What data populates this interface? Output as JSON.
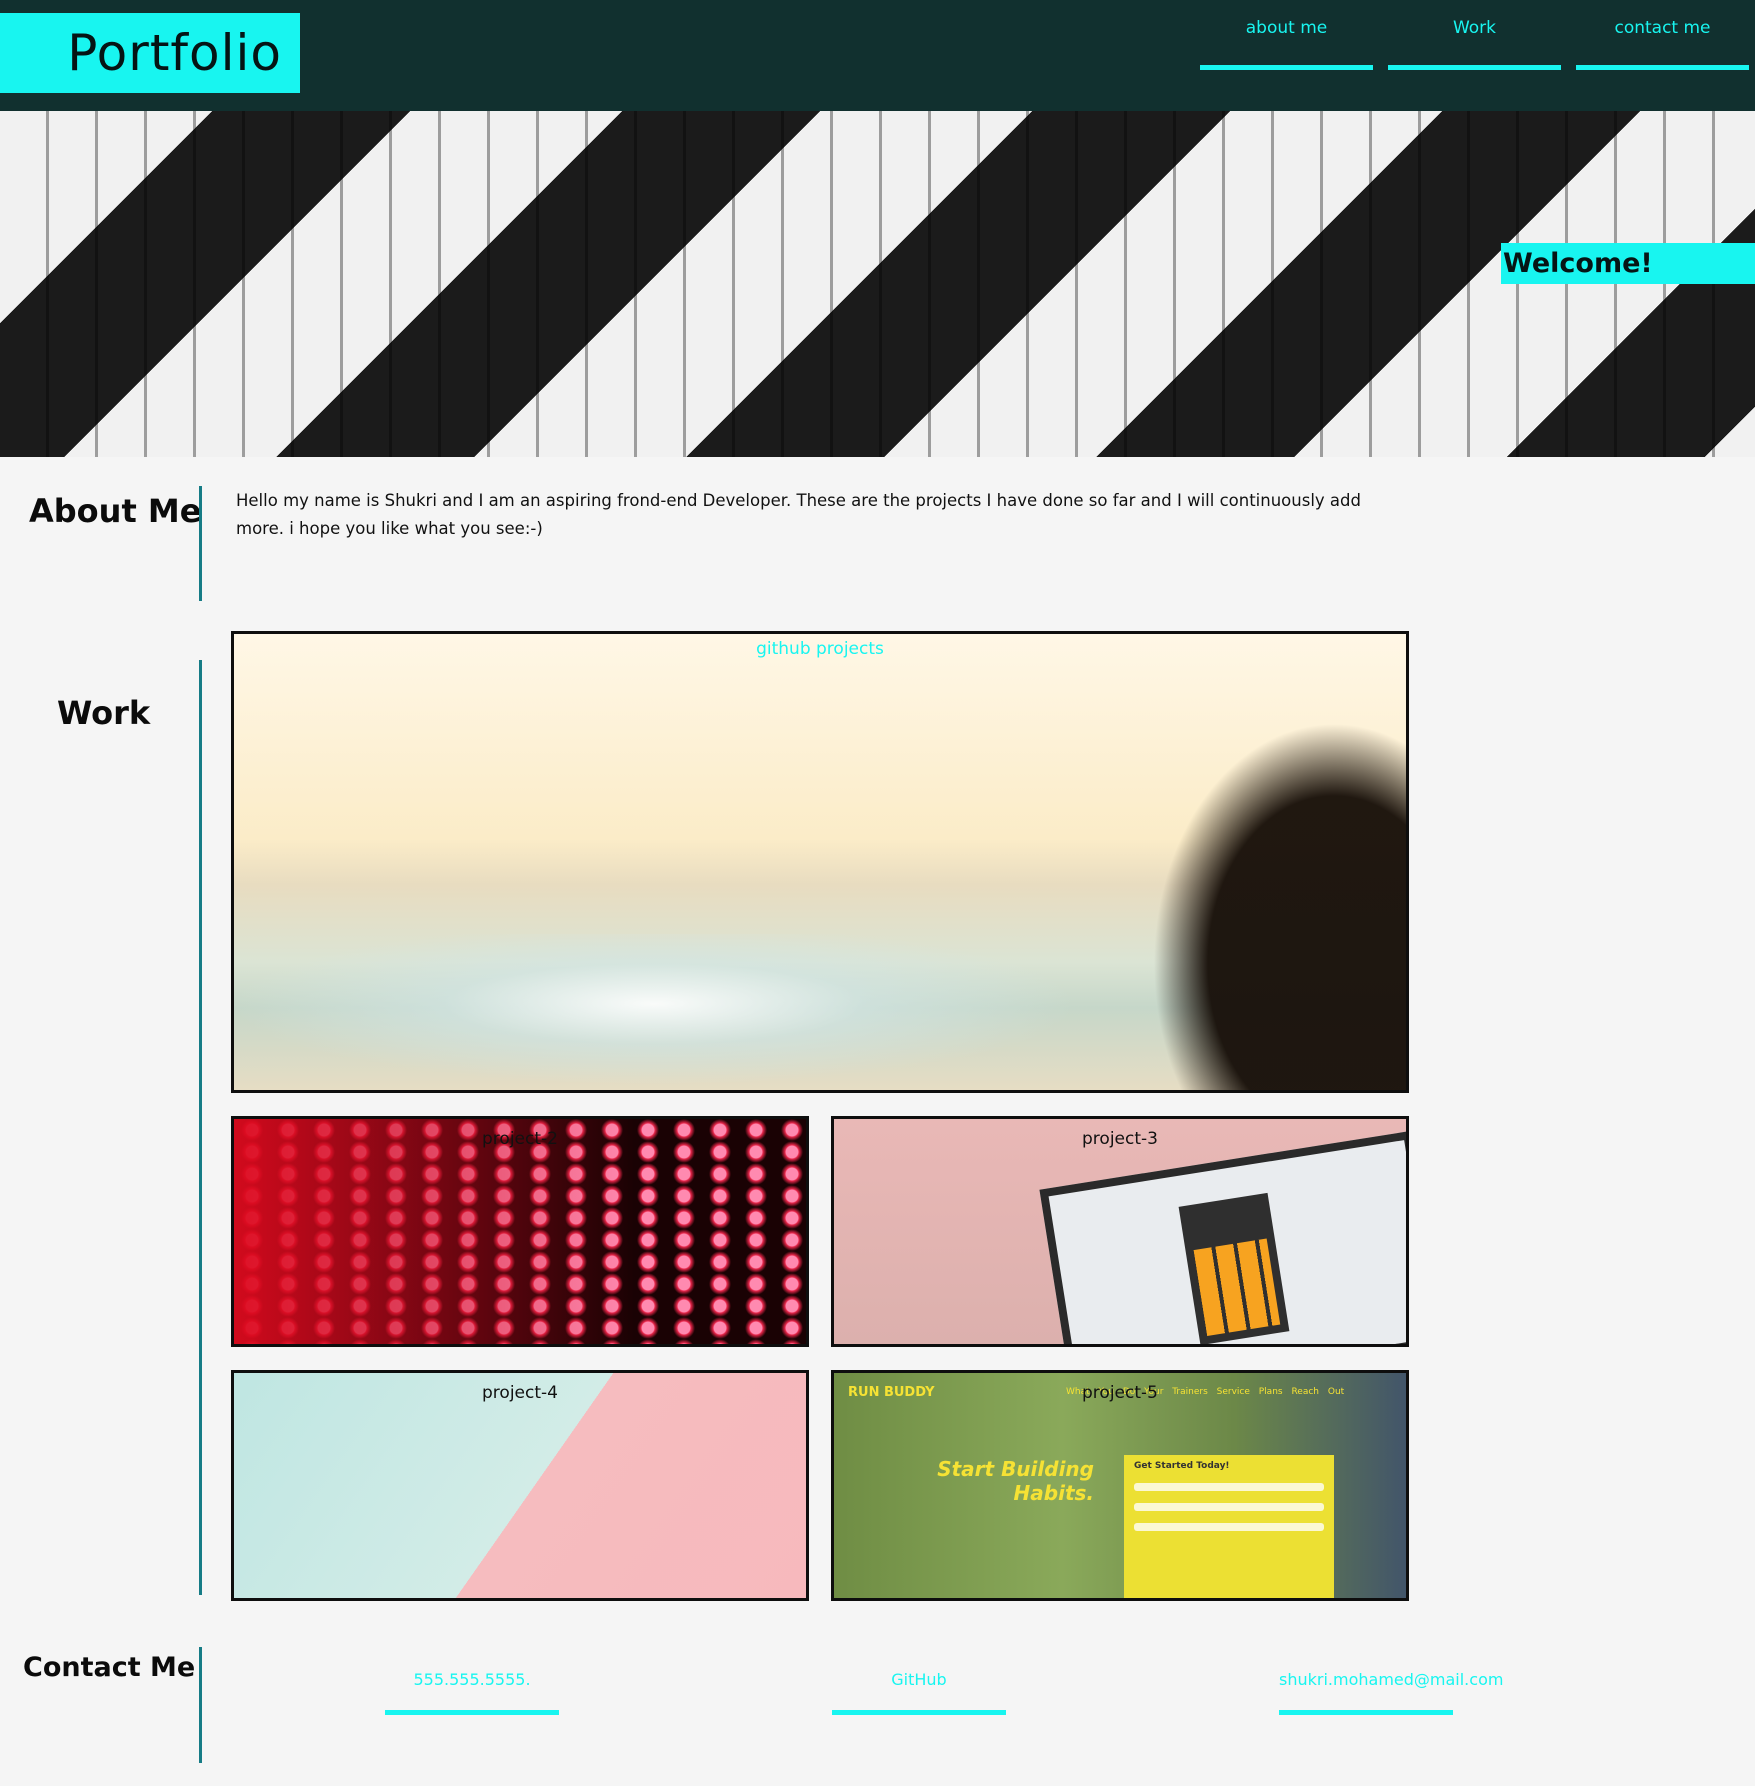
{
  "header": {
    "brand": "Portfolio",
    "nav": [
      {
        "label": "about me"
      },
      {
        "label": "Work"
      },
      {
        "label": "contact me"
      }
    ]
  },
  "hero": {
    "welcome": "Welcome!"
  },
  "about": {
    "title": "About Me",
    "text": "Hello my name is Shukri and I am an aspiring frond-end Developer. These are the projects I have done so far and I will continuously add more. i hope you like what you see:-)"
  },
  "work": {
    "title": "Work",
    "projects": [
      {
        "label": "github projects"
      },
      {
        "label": "project-2"
      },
      {
        "label": "project-3"
      },
      {
        "label": "project-4"
      },
      {
        "label": "project-5"
      }
    ],
    "project5_preview": {
      "brand": "RUN BUDDY",
      "nav": "What You Do   Your Trainers   Service Plans   Reach Out",
      "heading": "Start Building Habits.",
      "form_title": "Get Started Today!"
    }
  },
  "contact": {
    "title": "Contact Me",
    "items": [
      {
        "label": "555.555.5555."
      },
      {
        "label": "GitHub"
      },
      {
        "label": "shukri.mohamed@mail.com"
      }
    ]
  },
  "colors": {
    "accent": "#18f5f0",
    "header_bg": "#11302f",
    "divider": "#167c86",
    "page_bg": "#f5f5f5"
  }
}
